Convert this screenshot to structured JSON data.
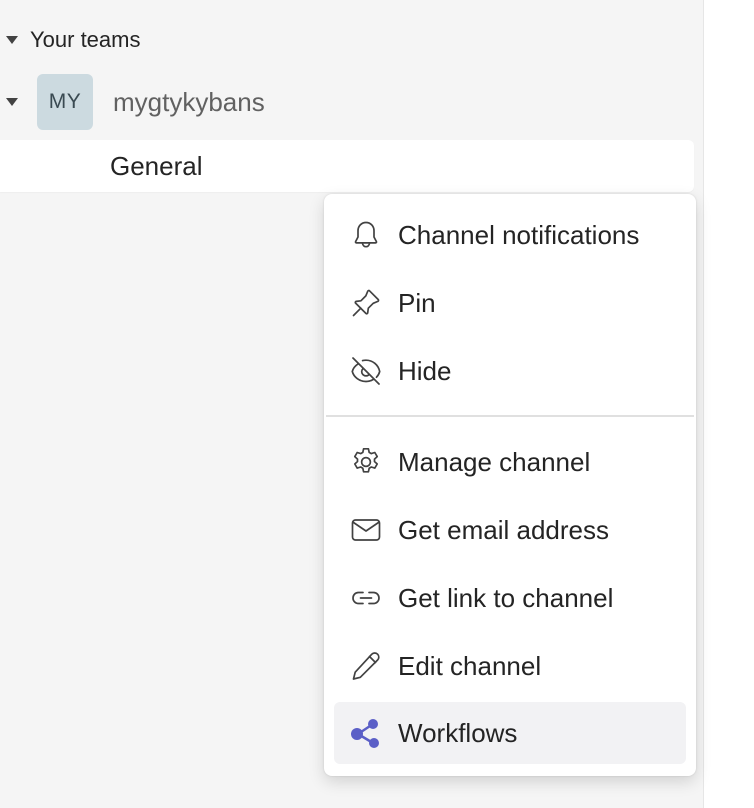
{
  "sidebar": {
    "section_title": "Your teams",
    "team": {
      "avatar_initials": "MY",
      "name": "mygtykybans"
    },
    "channel": {
      "name": "General"
    }
  },
  "context_menu": {
    "items": [
      {
        "label": "Channel notifications",
        "icon": "bell-icon"
      },
      {
        "label": "Pin",
        "icon": "pin-icon"
      },
      {
        "label": "Hide",
        "icon": "eye-off-icon"
      },
      {
        "label": "Manage channel",
        "icon": "gear-icon"
      },
      {
        "label": "Get email address",
        "icon": "mail-icon"
      },
      {
        "label": "Get link to channel",
        "icon": "link-icon"
      },
      {
        "label": "Edit channel",
        "icon": "pencil-icon"
      },
      {
        "label": "Workflows",
        "icon": "workflows-icon"
      }
    ]
  },
  "colors": {
    "workflows_accent": "#5b5fc7",
    "avatar_bg": "#ccdae0",
    "hover_bg": "#f2f2f4"
  }
}
